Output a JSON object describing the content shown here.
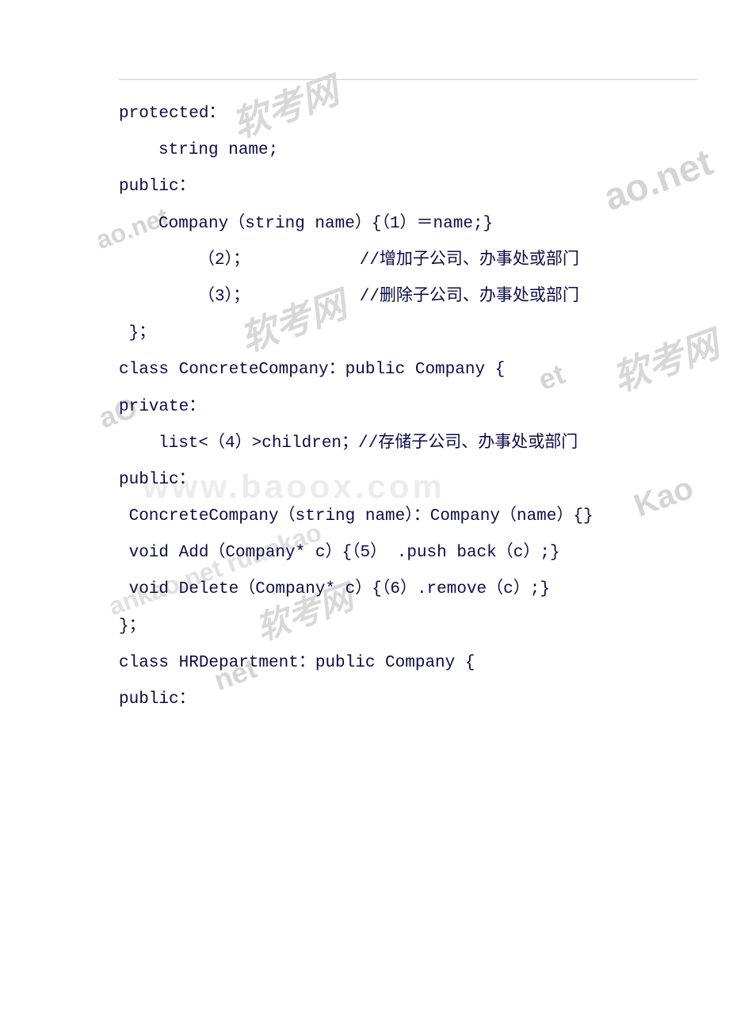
{
  "code": {
    "line1": "protected：",
    "line2": "string name;",
    "line3": "public：",
    "line4": "Company（string name）{（1）＝name;}",
    "line5": "（2）；           //增加子公司、办事处或部门",
    "line6": "（3）；           //删除子公司、办事处或部门",
    "line7": " }；",
    "line8": "class ConcreteCompany：public Company {",
    "line9": "private：",
    "line10": "list<（4）>children；//存储子公司、办事处或部门",
    "line11": "public：",
    "line12": " ConcreteCompany（string name）：Company（name）{}",
    "line13": " void Add（Company* c）{（5） .push back（c）;}",
    "line14": " void Delete（Company* c）{（6）.remove（c）;}",
    "line15": "}；",
    "line16": "class HRDepartment：public Company {",
    "line17": "public："
  },
  "watermarks": {
    "wm1": "软考网",
    "wm2": "ao.net",
    "wm3": "aO",
    "wm4": "软考网",
    "wm5": "软考网",
    "wm6": "et",
    "wm7": "Kao",
    "wm8": "net",
    "wm9": "ankao.net ruankao",
    "wm10": "www.baoox.com"
  }
}
